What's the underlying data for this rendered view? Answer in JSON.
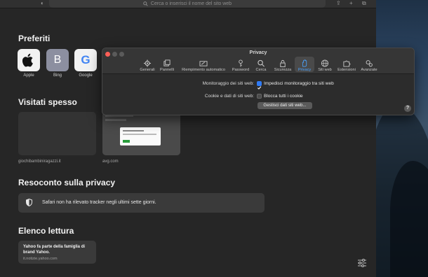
{
  "toolbar": {
    "address_placeholder": "Cerca o inserisci il nome del sito web"
  },
  "favorites": {
    "title": "Preferiti",
    "items": [
      {
        "label": "Apple",
        "icon": "apple-icon"
      },
      {
        "label": "Bing",
        "letter": "B"
      },
      {
        "label": "Google",
        "letter": "G"
      }
    ]
  },
  "frequent": {
    "title": "Visitati spesso",
    "items": [
      {
        "label": "giochibambiniragazzi.it"
      },
      {
        "label": "avg.com"
      }
    ]
  },
  "privacy_report": {
    "title": "Resoconto sulla privacy",
    "text": "Safari non ha rilevato tracker negli ultimi sette giorni."
  },
  "reading_list": {
    "title": "Elenco lettura",
    "items": [
      {
        "title": "Yahoo fa parte della famiglia di brand Yahoo.",
        "url": "it.notizie.yahoo.com"
      }
    ]
  },
  "preferences": {
    "title": "Privacy",
    "tabs": [
      {
        "label": "Generali",
        "icon": "gear-icon"
      },
      {
        "label": "Pannelli",
        "icon": "tabs-icon"
      },
      {
        "label": "Riempimento automatico",
        "icon": "autofill-icon"
      },
      {
        "label": "Password",
        "icon": "key-icon"
      },
      {
        "label": "Cerca",
        "icon": "search-icon"
      },
      {
        "label": "Sicurezza",
        "icon": "lock-icon"
      },
      {
        "label": "Privacy",
        "icon": "hand-icon",
        "active": true
      },
      {
        "label": "Siti web",
        "icon": "globe-icon"
      },
      {
        "label": "Estensioni",
        "icon": "puzzle-icon"
      },
      {
        "label": "Avanzate",
        "icon": "advanced-gears-icon"
      }
    ],
    "tracking_label": "Monitoraggio dei siti web:",
    "tracking_option": "Impedisci monitoraggio tra siti web",
    "tracking_checked": true,
    "cookies_label": "Cookie e dati di siti web:",
    "cookies_option": "Blocca tutti i cookie",
    "cookies_checked": false,
    "manage_button": "Gestisci dati siti web...",
    "help": "?"
  },
  "colors": {
    "accent": "#2f7bf6",
    "active_tab_text": "#4aa3ff",
    "traffic_red": "#ff5f57",
    "traffic_gray": "#5b5b5b"
  }
}
